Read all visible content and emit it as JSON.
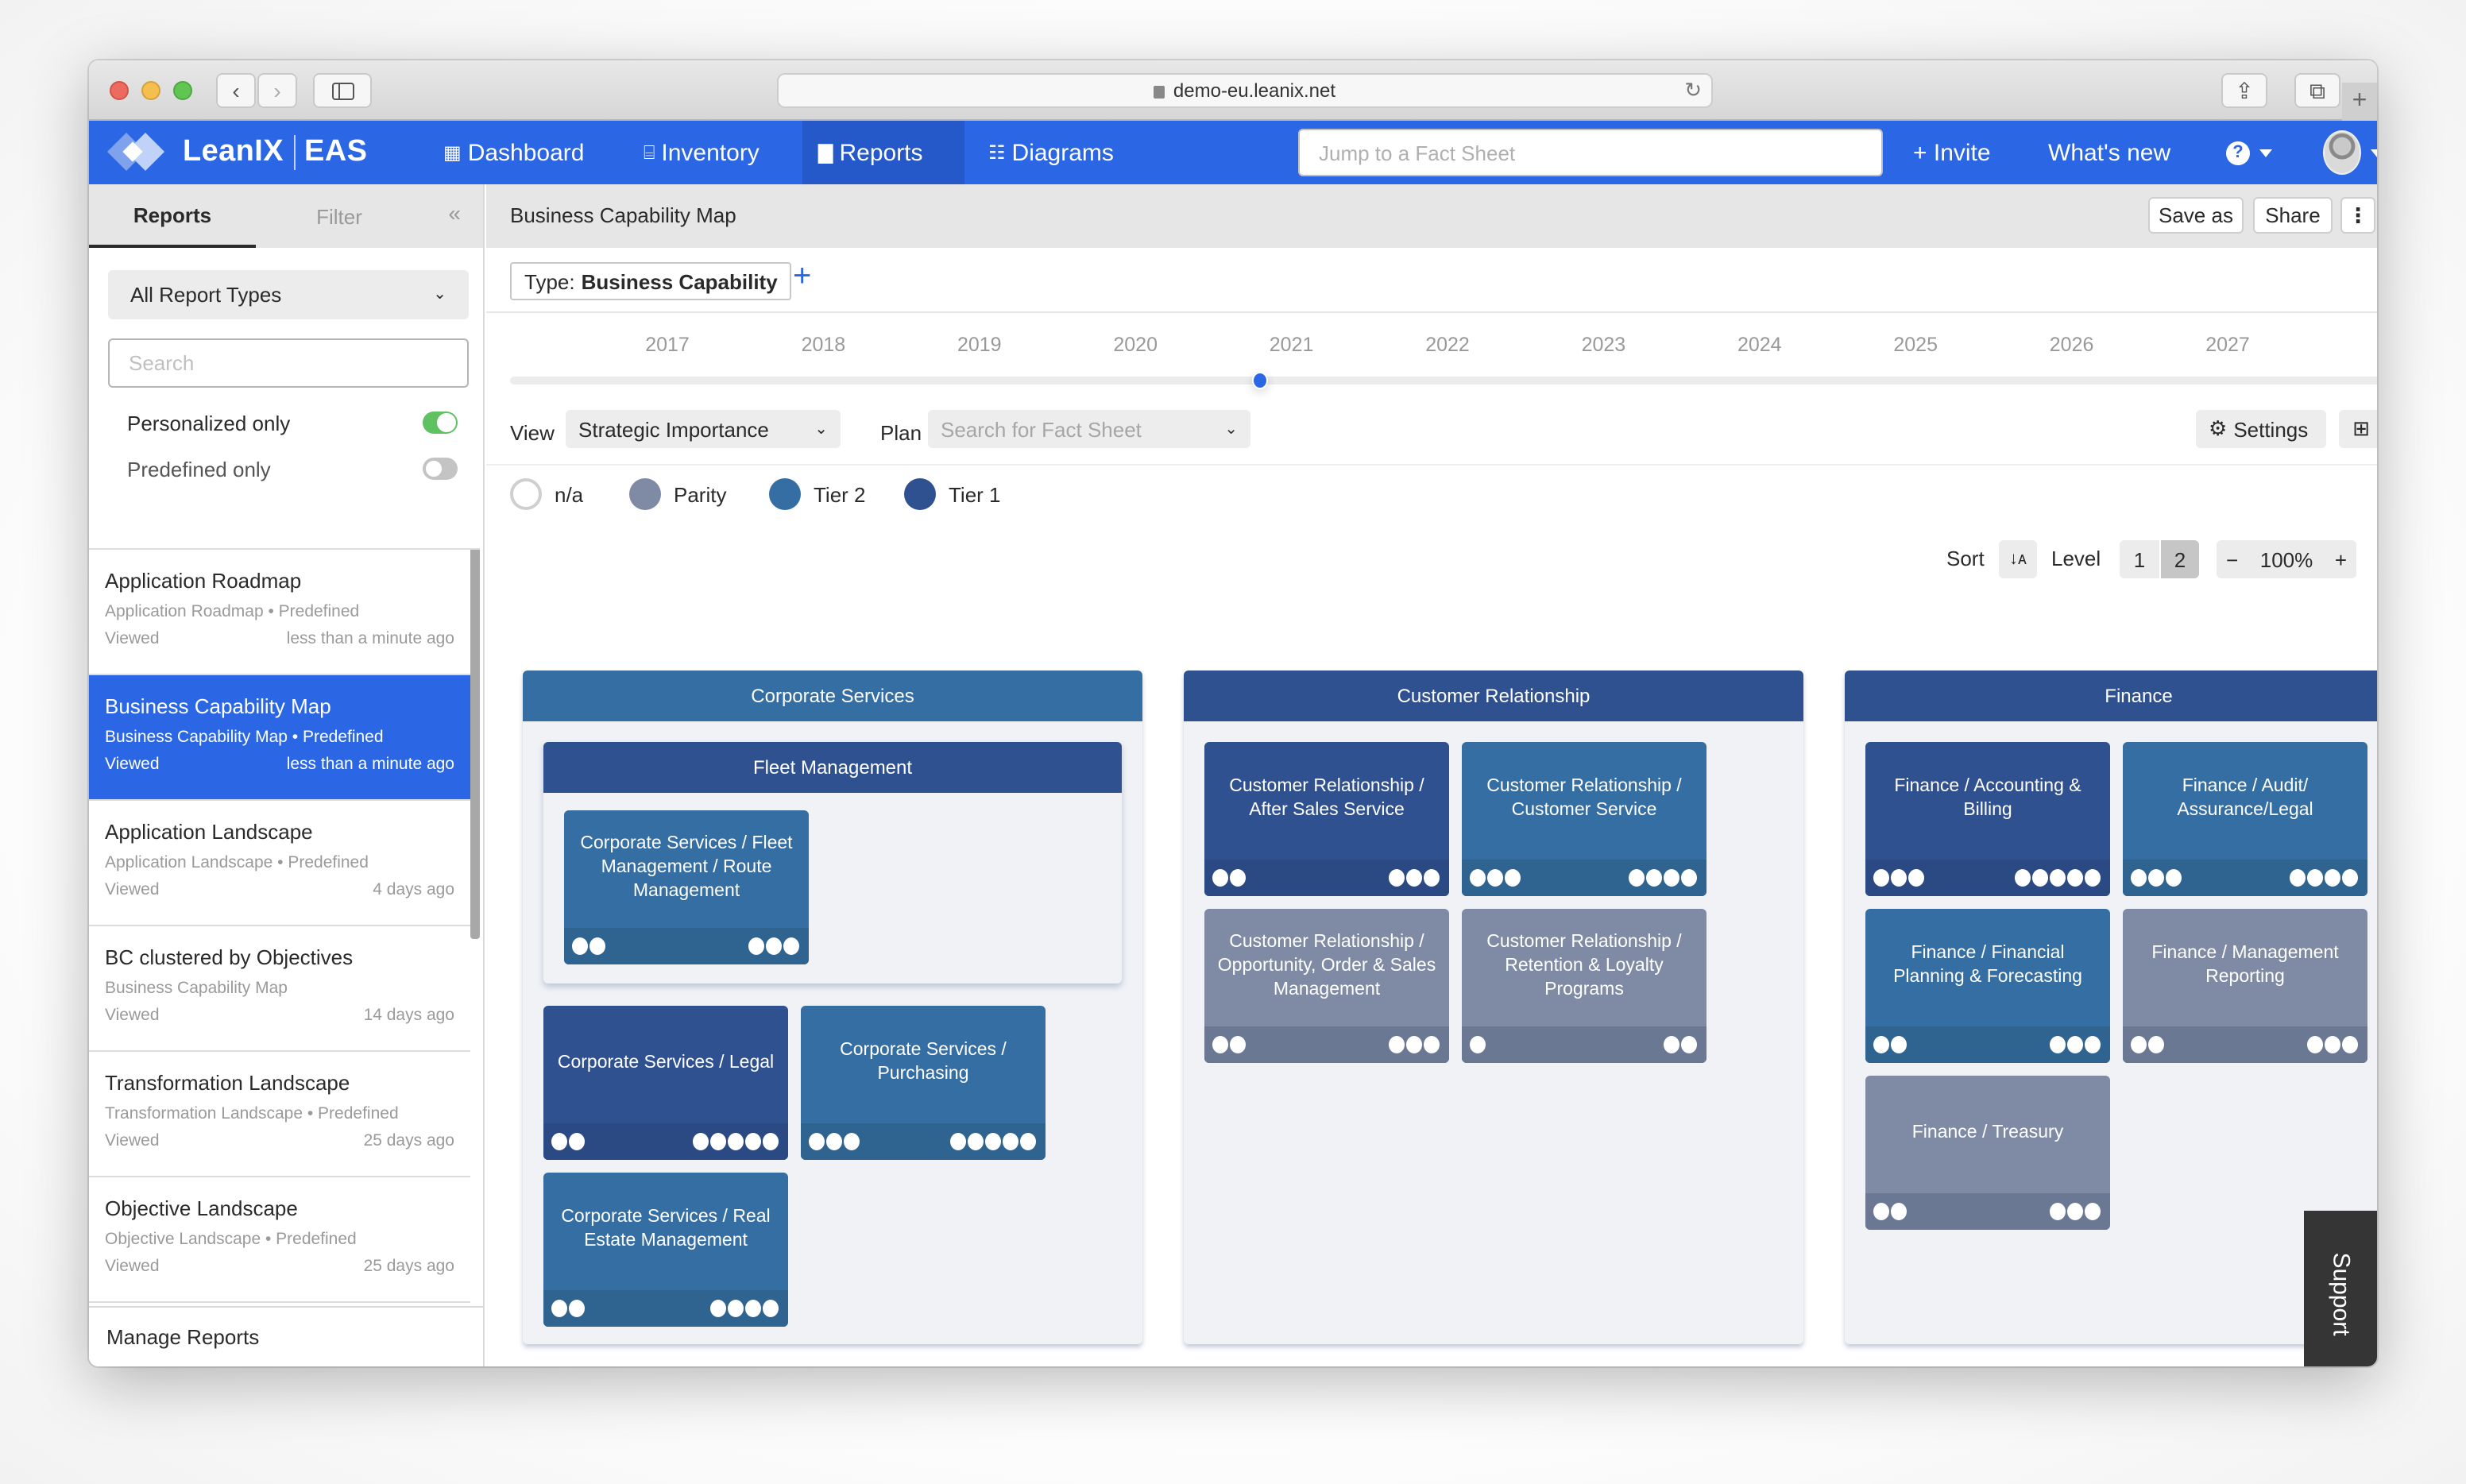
{
  "browser": {
    "url": "demo-eu.leanix.net",
    "back_icon": "chevron-left-icon",
    "forward_icon": "chevron-right-icon"
  },
  "nav": {
    "brand": "LeanIX",
    "product": "EAS",
    "items": [
      {
        "label": "Dashboard",
        "icon": "grid-icon"
      },
      {
        "label": "Inventory",
        "icon": "archive-icon"
      },
      {
        "label": "Reports",
        "icon": "bar-chart-icon",
        "active": true
      },
      {
        "label": "Diagrams",
        "icon": "sitemap-icon"
      }
    ],
    "search_placeholder": "Jump to a Fact Sheet",
    "invite": "+ Invite",
    "whats_new": "What's new",
    "help_glyph": "?"
  },
  "sidebar": {
    "tabs": [
      "Reports",
      "Filter"
    ],
    "collapse_glyph": "«",
    "report_type": "All Report Types",
    "search_placeholder": "Search",
    "toggles": [
      {
        "label": "Personalized only",
        "on": true
      },
      {
        "label": "Predefined only",
        "on": false
      }
    ],
    "reports": [
      {
        "title": "Application Roadmap",
        "sub": "Application Roadmap • Predefined",
        "viewed": "Viewed",
        "when": "less than a minute ago"
      },
      {
        "title": "Business Capability Map",
        "sub": "Business Capability Map • Predefined",
        "viewed": "Viewed",
        "when": "less than a minute ago",
        "active": true
      },
      {
        "title": "Application Landscape",
        "sub": "Application Landscape • Predefined",
        "viewed": "Viewed",
        "when": "4 days ago"
      },
      {
        "title": "BC clustered by Objectives",
        "sub": "Business Capability Map",
        "viewed": "Viewed",
        "when": "14 days ago"
      },
      {
        "title": "Transformation Landscape",
        "sub": "Transformation Landscape • Predefined",
        "viewed": "Viewed",
        "when": "25 days ago"
      },
      {
        "title": "Objective Landscape",
        "sub": "Objective Landscape • Predefined",
        "viewed": "Viewed",
        "when": "25 days ago"
      }
    ],
    "footer": "Manage Reports"
  },
  "main": {
    "title": "Business Capability Map",
    "save_as": "Save as",
    "share": "Share",
    "more_glyph": "⋮",
    "type_prefix": "Type:",
    "type_value": "Business Capability",
    "add_glyph": "+",
    "timeline": {
      "years": [
        "2017",
        "2018",
        "2019",
        "2020",
        "2021",
        "2022",
        "2023",
        "2024",
        "2025",
        "2026",
        "2027"
      ],
      "selected_position_years": 2020.8
    },
    "view_label": "View",
    "view_value": "Strategic Importance",
    "plan_label": "Plan",
    "plan_placeholder": "Search for Fact Sheet",
    "settings": "Settings",
    "legend": [
      {
        "label": "n/a",
        "color": "#ffffff"
      },
      {
        "label": "Parity",
        "color": "#7f8aa4"
      },
      {
        "label": "Tier 2",
        "color": "#356ea3"
      },
      {
        "label": "Tier 1",
        "color": "#30518f"
      }
    ],
    "sort_label": "Sort",
    "level_label": "Level",
    "levels": [
      "1",
      "2"
    ],
    "level_selected": "2",
    "zoom_minus": "−",
    "zoom_value": "100%",
    "zoom_plus": "+",
    "support": "Support"
  },
  "map": {
    "domains": [
      {
        "name": "Corporate Services",
        "tier": "tier2",
        "groups": [
          {
            "name": "Fleet Management",
            "tier": "tier1",
            "tiles": [
              {
                "label": "Corporate Services / Fleet Management / Route Management",
                "tier": "tier2",
                "left_dots": 2,
                "right_dots": 3
              }
            ]
          }
        ],
        "tiles": [
          {
            "label": "Corporate Services / Legal",
            "tier": "tier1",
            "left_dots": 2,
            "right_dots": 5
          },
          {
            "label": "Corporate Services / Purchasing",
            "tier": "tier2",
            "left_dots": 3,
            "right_dots": 5
          },
          {
            "label": "Corporate Services / Real Estate Management",
            "tier": "tier2",
            "left_dots": 2,
            "right_dots": 4
          }
        ]
      },
      {
        "name": "Customer Relationship",
        "tier": "tier1",
        "tiles": [
          {
            "label": "Customer Relationship / After Sales Service",
            "tier": "tier1",
            "left_dots": 2,
            "right_dots": 3
          },
          {
            "label": "Customer Relationship / Customer Service",
            "tier": "tier2",
            "left_dots": 3,
            "right_dots": 4
          },
          {
            "label": "Customer Relationship / Opportunity, Order & Sales Management",
            "tier": "parity",
            "left_dots": 2,
            "right_dots": 3
          },
          {
            "label": "Customer Relationship / Retention & Loyalty Programs",
            "tier": "parity",
            "left_dots": 1,
            "right_dots": 2
          }
        ]
      },
      {
        "name": "Finance",
        "tier": "tier1",
        "tiles": [
          {
            "label": "Finance / Accounting & Billing",
            "tier": "tier1",
            "left_dots": 3,
            "right_dots": 5
          },
          {
            "label": "Finance / Audit/ Assurance/Legal",
            "tier": "tier2",
            "left_dots": 3,
            "right_dots": 4
          },
          {
            "label": "Finance / Financial Planning & Forecasting",
            "tier": "tier2",
            "left_dots": 2,
            "right_dots": 3
          },
          {
            "label": "Finance / Management Reporting",
            "tier": "parity",
            "left_dots": 2,
            "right_dots": 3
          },
          {
            "label": "Finance / Treasury",
            "tier": "parity",
            "left_dots": 2,
            "right_dots": 3
          }
        ]
      }
    ]
  }
}
